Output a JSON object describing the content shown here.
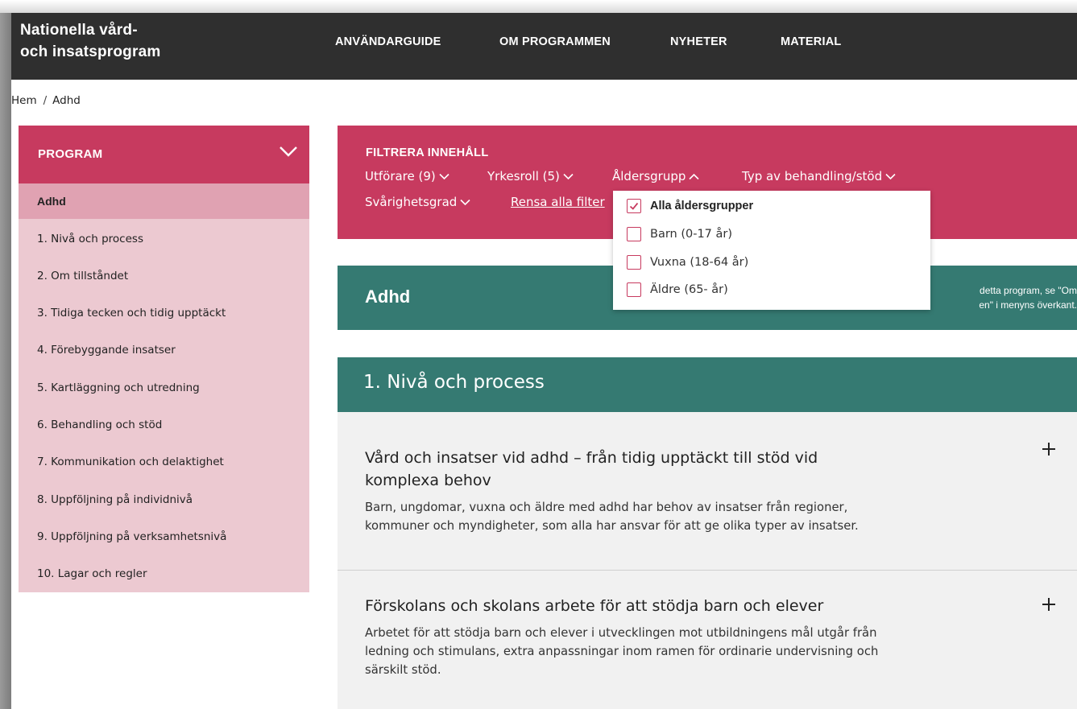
{
  "header": {
    "logo_line1": "Nationella vård-",
    "logo_line2": "och insatsprogram",
    "nav": [
      "ANVÄNDARGUIDE",
      "OM PROGRAMMEN",
      "NYHETER",
      "MATERIAL"
    ]
  },
  "breadcrumb": {
    "home": "Hem",
    "separator": "/",
    "current": "Adhd"
  },
  "sidebar": {
    "title": "PROGRAM",
    "items": [
      "Adhd",
      "1. Nivå och process",
      "2. Om tillståndet",
      "3. Tidiga tecken och tidig upptäckt",
      "4. Förebyggande insatser",
      "5. Kartläggning och utredning",
      "6. Behandling och stöd",
      "7. Kommunikation och delaktighet",
      "8. Uppföljning på individnivå",
      "9. Uppföljning på verksamhetsnivå",
      "10. Lagar och regler"
    ]
  },
  "filter": {
    "title": "FILTRERA INNEHÅLL",
    "items": [
      "Utförare (9)",
      "Yrkesroll (5)",
      "Åldersgrupp",
      "Typ av behandling/stöd",
      "Svårighetsgrad"
    ],
    "clear": "Rensa alla filter"
  },
  "dropdown": {
    "options": [
      "Alla åldersgrupper",
      "Barn (0-17 år)",
      "Vuxna (18-64 år)",
      "Äldre (65- år)"
    ],
    "checked": [
      true,
      false,
      false,
      false
    ]
  },
  "banner": {
    "title": "Adhd",
    "note_line1": "detta program, se \"Om",
    "note_line2": "en\" i menyns överkant."
  },
  "section": {
    "title": "1. Nivå och process",
    "cards": [
      {
        "title": "Vård och insatser vid adhd – från tidig upptäckt till stöd vid komplexa behov",
        "body": "Barn, ungdomar, vuxna och äldre med adhd har behov av insatser från regioner, kommuner och myndigheter, som alla har ansvar för att ge olika typer av insatser."
      },
      {
        "title": "Förskolans och skolans arbete för att stödja barn och elever",
        "body": "Arbetet för att stödja barn och elever i utvecklingen mot utbildningens mål utgår från ledning och stimulans, extra anpassningar inom ramen för ordinarie undervisning och särskilt stöd."
      }
    ]
  },
  "colors": {
    "header_bg": "#2f2f2f",
    "accent_red": "#c73a5f",
    "sidebar_bg": "#ecc9d1",
    "sidebar_active": "#e0a2b2",
    "teal": "#357a72",
    "card_bg": "#f1f1f1"
  },
  "icons": {
    "sidebar_toggle": "chevron-down-icon",
    "filter_closed": "chevron-down-icon",
    "filter_open": "chevron-up-icon",
    "checkbox_checked": "checkmark-icon",
    "card_expand": "plus-icon"
  }
}
